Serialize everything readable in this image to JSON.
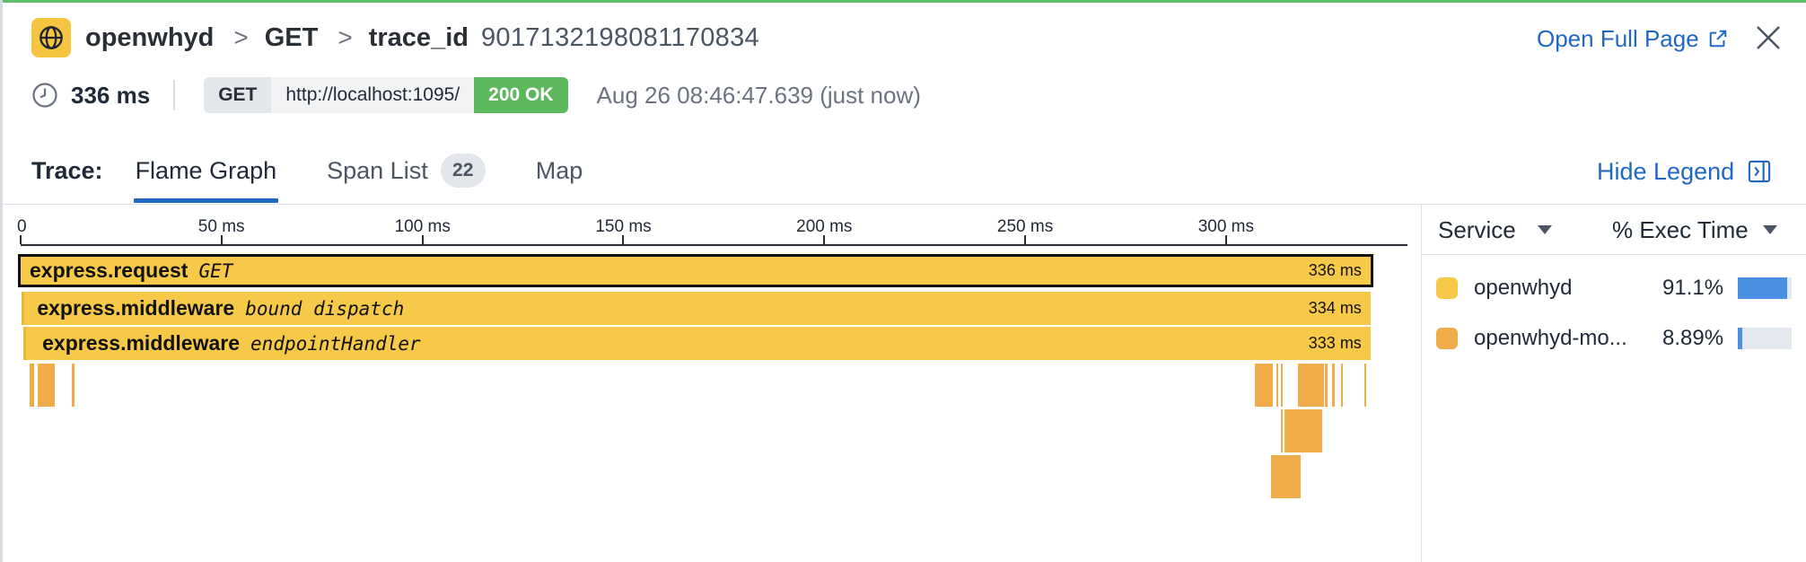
{
  "header": {
    "service": "openwhyd",
    "method": "GET",
    "trace_label": "trace_id",
    "trace_id": "9017132198081170834",
    "open_full_page": "Open Full Page"
  },
  "request": {
    "duration": "336 ms",
    "method": "GET",
    "url": "http://localhost:1095/",
    "status": "200 OK",
    "timestamp": "Aug 26 08:46:47.639 (just now)"
  },
  "tabs": {
    "label": "Trace:",
    "items": [
      {
        "label": "Flame Graph",
        "active": true
      },
      {
        "label": "Span List",
        "badge": "22"
      },
      {
        "label": "Map"
      }
    ],
    "hide_legend": "Hide Legend"
  },
  "flame": {
    "axis_max_ms": 336,
    "ticks": [
      "0",
      "50 ms",
      "100 ms",
      "150 ms",
      "200 ms",
      "250 ms",
      "300 ms"
    ],
    "tick_values": [
      0,
      50,
      100,
      150,
      200,
      250,
      300
    ],
    "spans": [
      {
        "name": "express.request",
        "resource": "GET",
        "duration": "336 ms",
        "start_ms": 0,
        "dur_ms": 336,
        "depth": 0,
        "selected": true
      },
      {
        "name": "express.middleware",
        "resource": "bound dispatch",
        "duration": "334 ms",
        "start_ms": 0.3,
        "dur_ms": 335.7,
        "depth": 1
      },
      {
        "name": "express.middleware",
        "resource": "endpointHandler",
        "duration": "333 ms",
        "start_ms": 0.7,
        "dur_ms": 335.3,
        "depth": 2
      }
    ],
    "mini_spans": [
      {
        "start_ms": 2.2,
        "dur_ms": 1.1,
        "depth": 3
      },
      {
        "start_ms": 4.2,
        "dur_ms": 4.2,
        "depth": 3
      },
      {
        "start_ms": 12.8,
        "dur_ms": 0.6,
        "depth": 3
      },
      {
        "start_ms": 307.2,
        "dur_ms": 4.4,
        "depth": 3
      },
      {
        "start_ms": 312.5,
        "dur_ms": 0.5,
        "depth": 3
      },
      {
        "start_ms": 313.6,
        "dur_ms": 0.6,
        "depth": 3
      },
      {
        "start_ms": 318.0,
        "dur_ms": 6.4,
        "depth": 3
      },
      {
        "start_ms": 324.7,
        "dur_ms": 0.6,
        "depth": 3
      },
      {
        "start_ms": 326.4,
        "dur_ms": 0.6,
        "depth": 3
      },
      {
        "start_ms": 328.6,
        "dur_ms": 0.6,
        "depth": 3
      },
      {
        "start_ms": 334.4,
        "dur_ms": 0.6,
        "depth": 3
      },
      {
        "start_ms": 313.6,
        "dur_ms": 0.6,
        "depth": 4
      },
      {
        "start_ms": 314.6,
        "dur_ms": 9.4,
        "depth": 4
      },
      {
        "start_ms": 311.2,
        "dur_ms": 7.5,
        "depth": 5
      }
    ]
  },
  "legend": {
    "col_service": "Service",
    "col_exec": "% Exec Time",
    "rows": [
      {
        "name": "openwhyd",
        "pct": "91.1%",
        "value": 91.1,
        "color": "#f7c948"
      },
      {
        "name": "openwhyd-mo...",
        "pct": "8.89%",
        "value": 8.89,
        "color": "#f0ac48"
      }
    ]
  },
  "colors": {
    "accent": "#2168c4",
    "span": "#f7c948",
    "span_child": "#f0ac48",
    "status_ok": "#5cb85c"
  }
}
